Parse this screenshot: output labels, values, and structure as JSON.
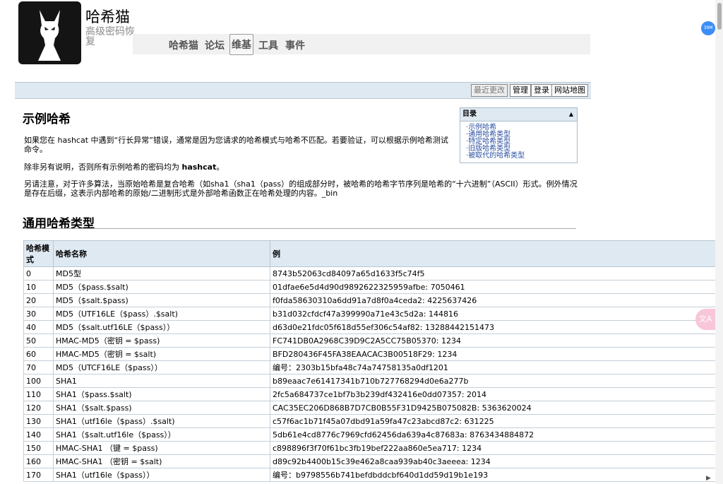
{
  "header": {
    "site_title": "哈希猫",
    "site_subtitle": "高级密码恢复",
    "nav": [
      "哈希猫",
      "论坛",
      "维基",
      "工具",
      "事件"
    ]
  },
  "actions": {
    "recent_changes": "最近更改",
    "manage": "管理",
    "login": "登录",
    "sitemap": "网站地图"
  },
  "toc": {
    "title": "目录",
    "items": [
      "示例哈希",
      "通用哈希类型",
      "特定哈希类型",
      "旧版哈希类型",
      "被取代的哈希类型"
    ]
  },
  "content": {
    "heading1": "示例哈希",
    "p1": "如果您在 hashcat 中遇到“行长异常”错误，通常是因为您请求的哈希模式与哈希不匹配。若要验证，可以根据示例哈希测试命令。",
    "p2_prefix": "除非另有说明，否则所有示例哈希的密码均为 ",
    "p2_bold": "hashcat",
    "p2_suffix": "。",
    "p3": "另请注意，对于许多算法，当原始哈希是复合哈希（如sha1（sha1（pass）的组成部分时，被哈希的哈希字节序列是哈希的“十六进制”（ASCII）形式。例外情况是存在后缀，这表示内部哈希的原始/二进制形式是外部哈希函数正在哈希处理的内容。_bin",
    "heading2": "通用哈希类型"
  },
  "table": {
    "headers": [
      "哈希模式",
      "哈希名称",
      "例"
    ],
    "rows": [
      [
        "0",
        "MD5型",
        "8743b52063cd84097a65d1633f5c74f5"
      ],
      [
        "10",
        "MD5（$pass.$salt)",
        "01dfae6e5d4d90d9892622325959afbe: 7050461"
      ],
      [
        "20",
        "MD5（$salt.$pass)",
        "f0fda58630310a6dd91a7d8f0a4ceda2: 4225637426"
      ],
      [
        "30",
        "MD5（UTF16LE（$pass）.$salt)",
        "b31d032cfdcf47a399990a71e43c5d2a: 144816"
      ],
      [
        "40",
        "MD5（$salt.utf16LE（$pass））",
        "d63d0e21fdc05f618d55ef306c54af82: 13288442151473"
      ],
      [
        "50",
        "HMAC-MD5（密钥 = $pass)",
        "FC741DB0A2968C39D9C2A5CC75B05370: 1234"
      ],
      [
        "60",
        "HMAC-MD5（密钥 = $salt)",
        "BFD280436F45FA38EAACAC3B00518F29: 1234"
      ],
      [
        "70",
        "MD5（UTCF16LE（$pass））",
        "编号：2303b15bfa48c74a74758135a0df1201"
      ],
      [
        "100",
        "SHA1",
        "b89eaac7e61417341b710b727768294d0e6a277b"
      ],
      [
        "110",
        "SHA1（$pass.$salt)",
        "2fc5a684737ce1bf7b3b239df432416e0dd07357: 2014"
      ],
      [
        "120",
        "SHA1（$salt.$pass)",
        "CAC35EC206D868B7D7CB0B55F31D9425B075082B: 5363620024"
      ],
      [
        "130",
        "SHA1（utf16le（$pass）.$salt)",
        "c57f6ac1b71f45a07dbd91a59fa47c23abcd87c2: 631225"
      ],
      [
        "140",
        "SHA1（$salt.utf16le（$pass））",
        "5db61e4cd8776c7969cfd62456da639a4c87683a: 8763434884872"
      ],
      [
        "150",
        "HMAC-SHA1 （键 = $pass)",
        "c898896f3f70f61bc3fb19bef222aa860e5ea717: 1234"
      ],
      [
        "160",
        "HMAC-SHA1 （密钥 = $salt)",
        "d89c92b4400b15c39e462a8caa939ab40c3aeeea: 1234"
      ],
      [
        "170",
        "SHA1（utf16le（$pass））",
        "编号：b9798556b741befdbddcbf640d1dd59d19b1e193"
      ]
    ]
  },
  "floaters": {
    "badge": "39M",
    "translate": "文A"
  }
}
